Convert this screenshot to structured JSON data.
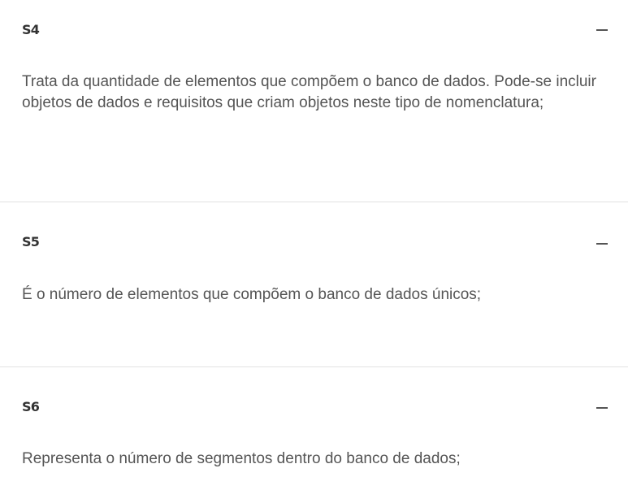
{
  "accordion": {
    "items": [
      {
        "title": "S4",
        "toggle_icon": "minus-icon",
        "expanded": true,
        "text": "Trata da quantidade de elementos que compõem o banco de dados. Pode-se incluir objetos de dados e requisitos que criam objetos neste tipo de nomenclatura;"
      },
      {
        "title": "S5",
        "toggle_icon": "minus-icon",
        "expanded": true,
        "text": "É o número de elementos que compõem o banco de dados únicos;"
      },
      {
        "title": "S6",
        "toggle_icon": "minus-icon",
        "expanded": true,
        "text": "Representa o número de segmentos dentro do banco de dados;"
      }
    ]
  },
  "colors": {
    "background": "#ffffff",
    "title": "#333333",
    "body_text": "#555555",
    "divider": "#e2e2e2",
    "icon": "#555555"
  }
}
